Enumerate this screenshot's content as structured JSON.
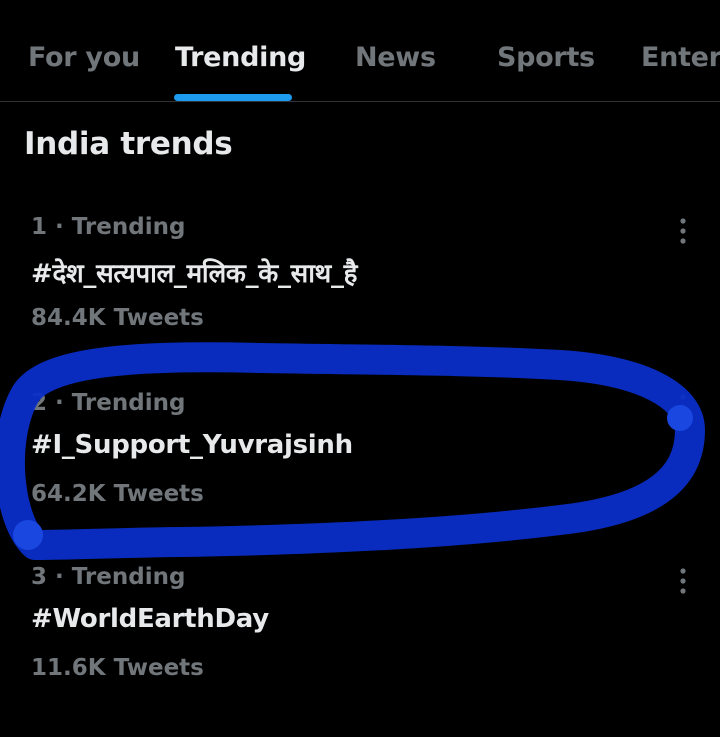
{
  "tabs": [
    {
      "label": "For you",
      "active": false
    },
    {
      "label": "Trending",
      "active": true
    },
    {
      "label": "News",
      "active": false
    },
    {
      "label": "Sports",
      "active": false
    },
    {
      "label": "Entert",
      "active": false
    }
  ],
  "section": {
    "title": "India trends"
  },
  "trends": [
    {
      "rank": "1",
      "category": "Trending",
      "meta": "1 · Trending",
      "name": "#देश_सत्यपाल_मलिक_के_साथ_है",
      "count": "84.4K Tweets"
    },
    {
      "rank": "2",
      "category": "Trending",
      "meta": "2 · Trending",
      "name": "#I_Support_Yuvrajsinh",
      "count": "64.2K Tweets"
    },
    {
      "rank": "3",
      "category": "Trending",
      "meta": "3 · Trending",
      "name": "#WorldEarthDay",
      "count": "11.6K Tweets"
    }
  ],
  "icons": {
    "more": "more-vertical-icon"
  },
  "colors": {
    "background": "#000000",
    "text_primary": "#e7e9ea",
    "text_secondary": "#71767b",
    "accent": "#1d9bf0",
    "divider": "#2f3336",
    "scribble": "#0a2ec8"
  }
}
